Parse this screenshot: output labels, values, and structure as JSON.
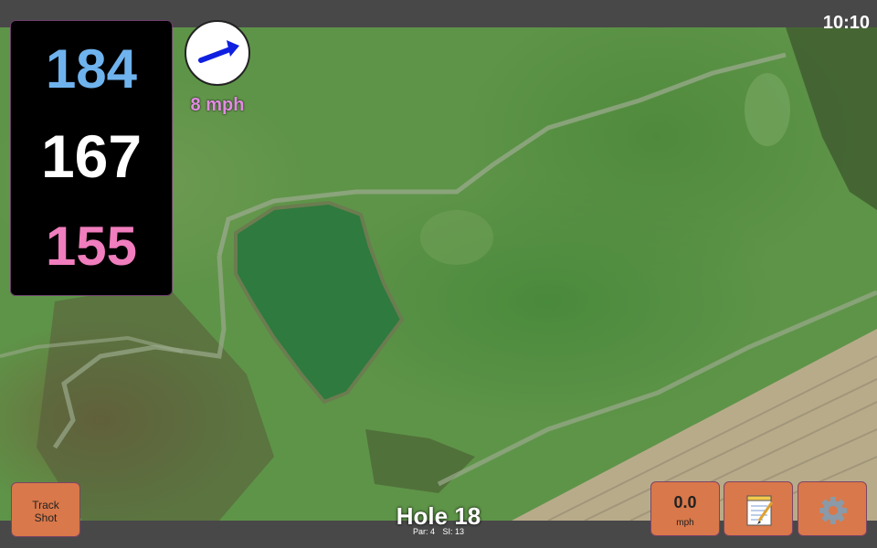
{
  "status_bar": {
    "time": "10:10"
  },
  "distances": {
    "back": "184",
    "middle": "167",
    "front": "155"
  },
  "wind": {
    "speed": "8 mph",
    "direction_icon": "arrow-icon"
  },
  "buttons": {
    "track_shot": {
      "line1": "Track",
      "line2": "Shot"
    },
    "speed": {
      "value": "0.0",
      "unit": "mph"
    },
    "notes_icon": "notepad-icon",
    "settings_icon": "gear-icon"
  },
  "hole": {
    "title": "Hole 18",
    "par": "Par: 4",
    "si": "SI: 13"
  },
  "colors": {
    "back": "#6fb3ee",
    "middle": "#ffffff",
    "front": "#f07dbd",
    "wind_text": "#e28be2",
    "button": "#d9784a",
    "arrow": "#1020e0"
  }
}
